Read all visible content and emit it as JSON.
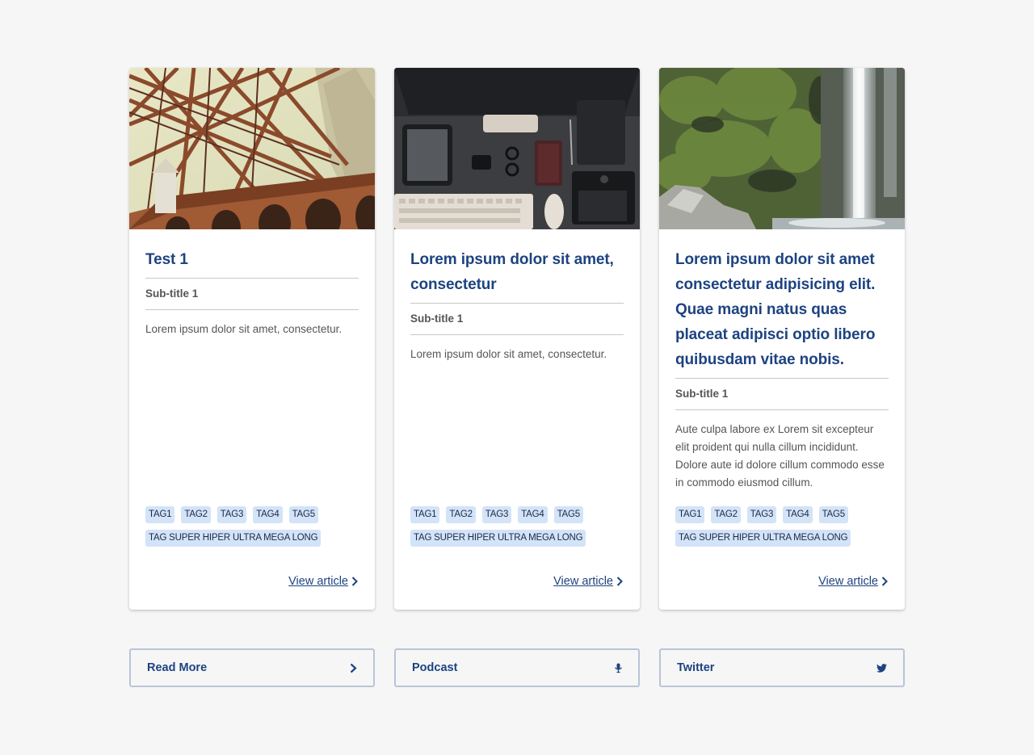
{
  "cards": [
    {
      "image": "bridge-photo",
      "title": "Test 1",
      "subtitle": "Sub-title 1",
      "text": "Lorem ipsum dolor sit amet, consectetur.",
      "tags": [
        "TAG1",
        "TAG2",
        "TAG3",
        "TAG4",
        "TAG5"
      ],
      "long_tag": "TAG SUPER HIPER ULTRA MEGA LONG",
      "link": "View article"
    },
    {
      "image": "desk-photo",
      "title": "Lorem ipsum dolor sit amet, consectetur",
      "subtitle": "Sub-title 1",
      "text": "Lorem ipsum dolor sit amet, consectetur.",
      "tags": [
        "TAG1",
        "TAG2",
        "TAG3",
        "TAG4",
        "TAG5"
      ],
      "long_tag": "TAG SUPER HIPER ULTRA MEGA LONG",
      "link": "View article"
    },
    {
      "image": "waterfall-photo",
      "title": "Lorem ipsum dolor sit amet consectetur adipisicing elit. Quae magni natus quas placeat adipisci optio libero quibusdam vitae nobis.",
      "subtitle": "Sub-title 1",
      "text": "Aute culpa labore ex Lorem sit excepteur elit proident qui nulla cillum incididunt. Dolore aute id dolore cillum commodo esse in commodo eiusmod cillum.",
      "tags": [
        "TAG1",
        "TAG2",
        "TAG3",
        "TAG4",
        "TAG5"
      ],
      "long_tag": "TAG SUPER HIPER ULTRA MEGA LONG",
      "link": "View article"
    }
  ],
  "buttons": [
    {
      "label": "Read More",
      "icon": "chevron-right-icon"
    },
    {
      "label": "Podcast",
      "icon": "microphone-icon"
    },
    {
      "label": "Twitter",
      "icon": "twitter-icon"
    }
  ],
  "colors": {
    "background": "#f6f6f6",
    "title": "#1d4380",
    "tag_bg": "#d3e3f8",
    "button_border": "#b9c4d8"
  }
}
